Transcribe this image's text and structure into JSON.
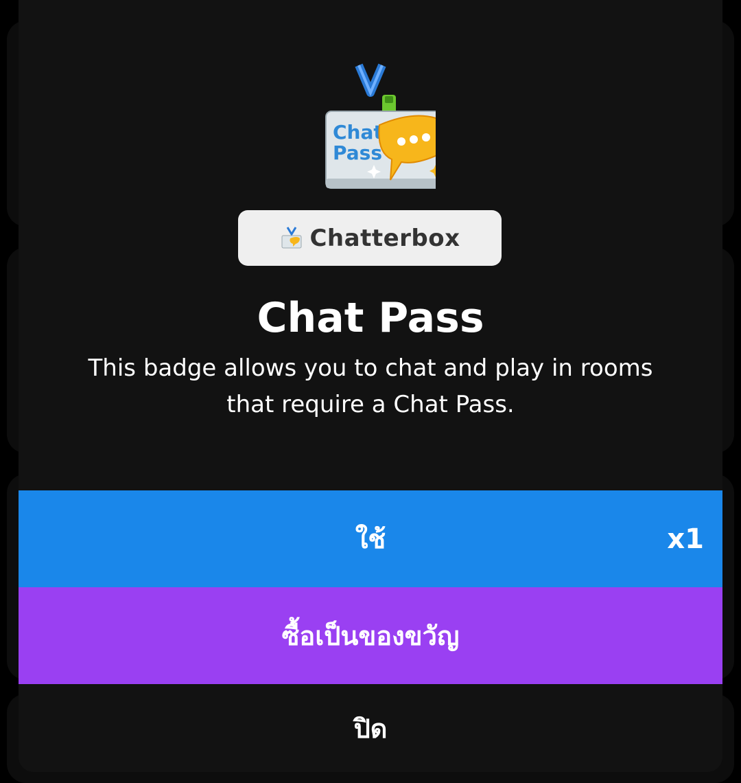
{
  "badge": {
    "category_label": "Chatterbox",
    "art_text_line1": "Chat",
    "art_text_line2": "Pass",
    "title": "Chat Pass",
    "description": "This badge allows you to chat and play in rooms that require a Chat Pass."
  },
  "actions": {
    "use_label": "ใช้",
    "use_quantity": "x1",
    "gift_label": "ซื้อเป็นของขวัญ",
    "close_label": "ปิด"
  },
  "colors": {
    "use_button": "#1a87ea",
    "gift_button": "#9a40f2",
    "modal_background": "#121212"
  },
  "icons": {
    "badge_art": "chat-pass-lanyard-badge",
    "tag_icon": "chat-pass-mini-icon"
  }
}
